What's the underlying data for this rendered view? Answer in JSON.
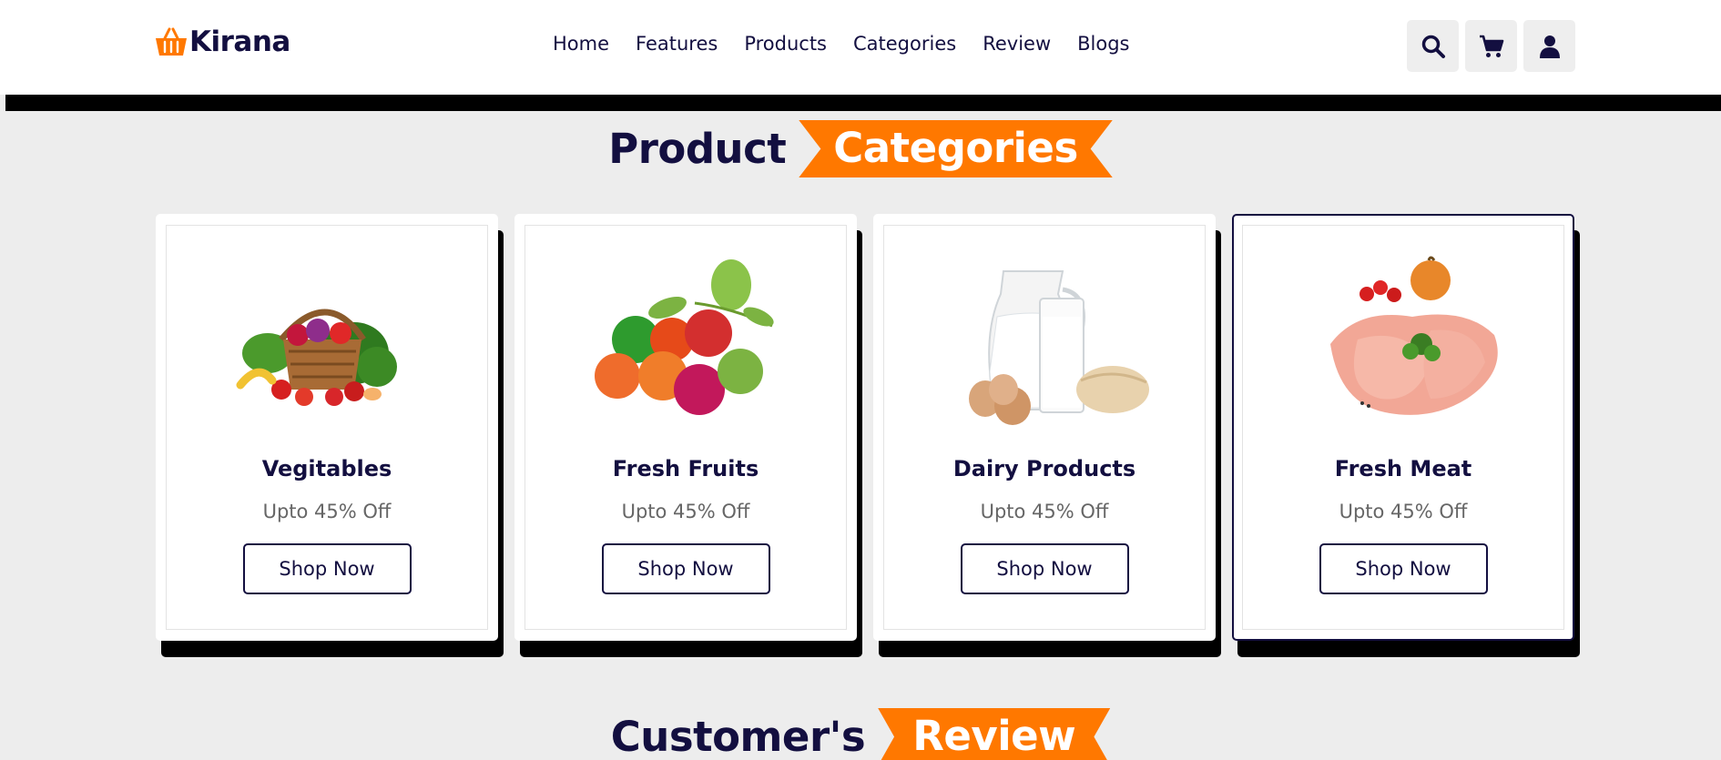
{
  "brand": {
    "name": "Kirana",
    "icon": "shopping-basket-icon",
    "accent": "#ff7800",
    "dark": "#130f40"
  },
  "nav": {
    "items": [
      {
        "label": "Home"
      },
      {
        "label": "Features"
      },
      {
        "label": "Products"
      },
      {
        "label": "Categories"
      },
      {
        "label": "Review"
      },
      {
        "label": "Blogs"
      }
    ]
  },
  "header_icons": [
    "search-icon",
    "cart-icon",
    "user-icon"
  ],
  "categories_heading": {
    "part1": "Product",
    "part2": "Categories"
  },
  "cards": [
    {
      "title": "Vegitables",
      "subtitle": "Upto 45% Off",
      "button": "Shop Now",
      "image": "vegetable-basket"
    },
    {
      "title": "Fresh Fruits",
      "subtitle": "Upto 45% Off",
      "button": "Shop Now",
      "image": "fruits"
    },
    {
      "title": "Dairy Products",
      "subtitle": "Upto 45% Off",
      "button": "Shop Now",
      "image": "milk-eggs-bread"
    },
    {
      "title": "Fresh Meat",
      "subtitle": "Upto 45% Off",
      "button": "Shop Now",
      "image": "raw-chicken"
    }
  ],
  "review_heading": {
    "part1": "Customer's",
    "part2": "Review"
  }
}
